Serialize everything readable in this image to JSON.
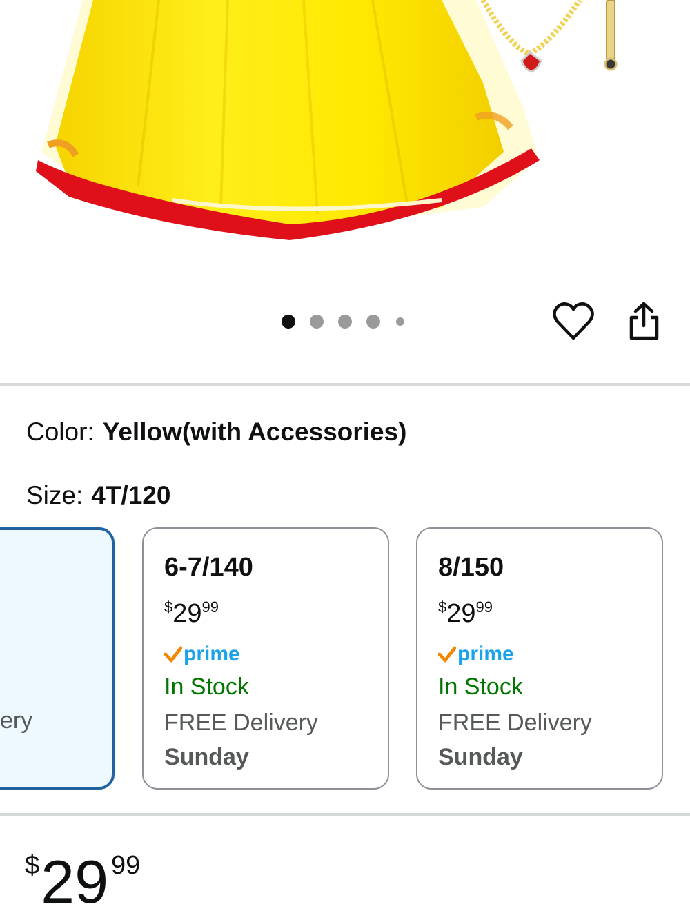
{
  "variations": {
    "color_label": "Color:",
    "color_value": "Yellow(with Accessories)",
    "size_label": "Size:",
    "size_value": "4T/120"
  },
  "carousel": {
    "dot_count": 5,
    "active_index": 0
  },
  "actions": {
    "wishlist_icon": "heart-icon",
    "share_icon": "share-icon"
  },
  "size_options": [
    {
      "partial_text": "ery",
      "selected": true
    },
    {
      "size": "6-7/140",
      "price_symbol": "$",
      "price_whole": "29",
      "price_cents": "99",
      "prime": "prime",
      "stock": "In Stock",
      "delivery": "FREE Delivery",
      "delivery_day": "Sunday"
    },
    {
      "size": "8/150",
      "price_symbol": "$",
      "price_whole": "29",
      "price_cents": "99",
      "prime": "prime",
      "stock": "In Stock",
      "delivery": "FREE Delivery",
      "delivery_day": "Sunday"
    }
  ],
  "price": {
    "symbol": "$",
    "whole": "29",
    "cents": "99"
  },
  "colors": {
    "accent_blue": "#2162a1",
    "selected_bg": "#edf8ff",
    "in_stock_green": "#007600",
    "prime_blue": "#1aa3e8",
    "prime_check_orange": "#f08804",
    "dress_yellow": "#ffe600",
    "ribbon_red": "#e0101a"
  }
}
